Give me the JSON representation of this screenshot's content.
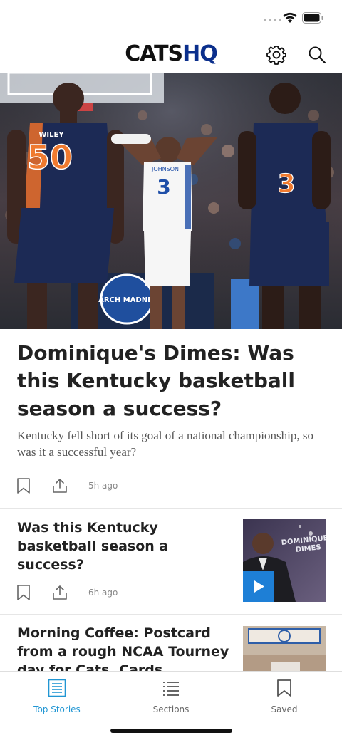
{
  "header": {
    "logo_part1": "CATS",
    "logo_part2": "HQ",
    "brand_color": "#0b2f8c",
    "icons": [
      "gear-icon",
      "search-icon"
    ]
  },
  "hero_story": {
    "image_desc_icons": [
      "hero-photo"
    ],
    "headline": "Dominique's Dimes: Was this Kentucky basketball season a success?",
    "summary": "Kentucky fell short of its goal of a national championship, so was it a successful year?",
    "age": "5h ago",
    "jersey_left": "50",
    "jersey_left_name": "WILEY",
    "jersey_center": "3",
    "jersey_center_name": "JOHNSON",
    "jersey_right": "3",
    "banner_text": "MARCH MADNESS"
  },
  "stories": [
    {
      "title": "Was this Kentucky basketball season a success?",
      "age": "6h ago",
      "thumb_text": "DOMINIQUE'S DIMES"
    },
    {
      "title": "Morning Coffee: Postcard from a rough NCAA Tourney day for Cats, Cards",
      "age": ""
    }
  ],
  "tabbar": {
    "tabs": [
      {
        "label": "Top Stories",
        "icon": "newspaper-icon",
        "active": true
      },
      {
        "label": "Sections",
        "icon": "list-icon",
        "active": false
      },
      {
        "label": "Saved",
        "icon": "bookmark-icon",
        "active": false
      }
    ],
    "accent": "#2196d3"
  }
}
